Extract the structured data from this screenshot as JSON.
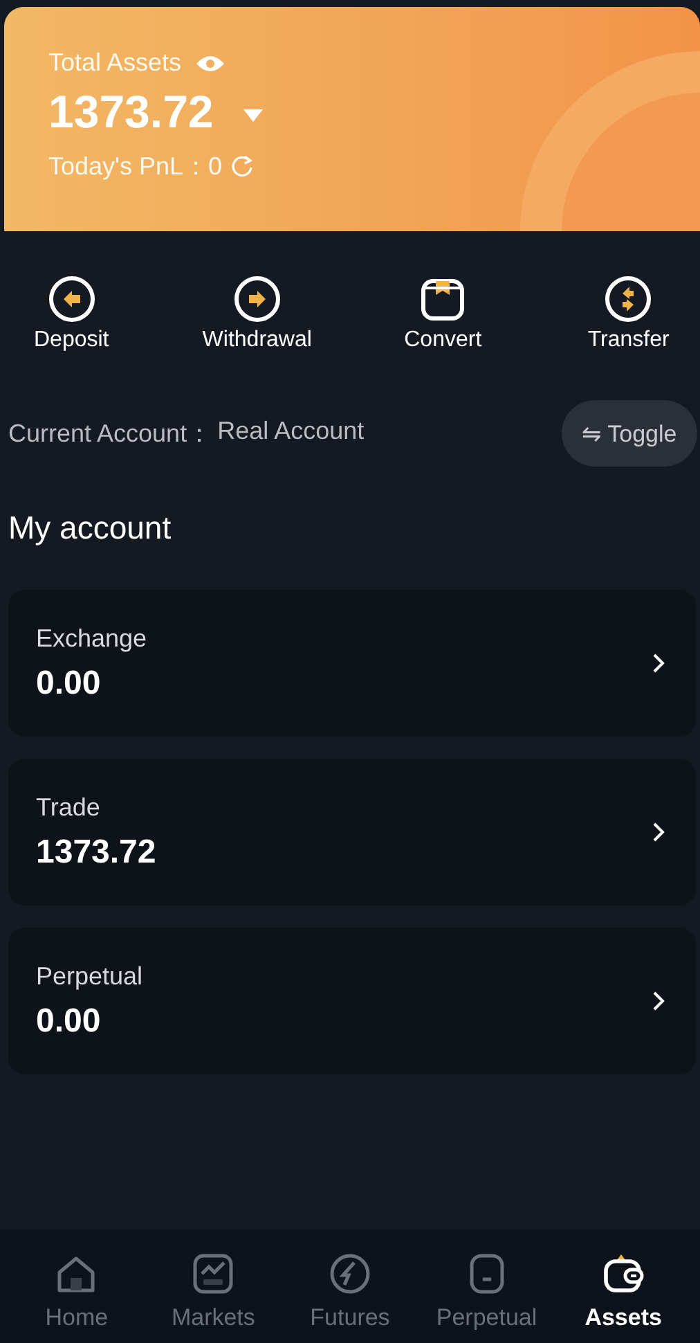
{
  "summary": {
    "title": "Total Assets",
    "total": "1373.72",
    "pnl_label": "Today's PnL：",
    "pnl_value": "0"
  },
  "actions": [
    {
      "kind": "deposit",
      "label": "Deposit"
    },
    {
      "kind": "withdrawal",
      "label": "Withdrawal"
    },
    {
      "kind": "convert",
      "label": "Convert"
    },
    {
      "kind": "transfer",
      "label": "Transfer"
    }
  ],
  "current_account": {
    "label": "Current Account：",
    "value": "Real Account",
    "toggle": "⇋ Toggle"
  },
  "section_title": "My account",
  "accounts": [
    {
      "name": "Exchange",
      "balance": "0.00"
    },
    {
      "name": "Trade",
      "balance": "1373.72"
    },
    {
      "name": "Perpetual",
      "balance": "0.00"
    }
  ],
  "tabs": [
    {
      "kind": "home",
      "label": "Home",
      "selected": false
    },
    {
      "kind": "markets",
      "label": "Markets",
      "selected": false
    },
    {
      "kind": "futures",
      "label": "Futures",
      "selected": false
    },
    {
      "kind": "perpetual",
      "label": "Perpetual",
      "selected": false
    },
    {
      "kind": "assets",
      "label": "Assets",
      "selected": true
    }
  ]
}
